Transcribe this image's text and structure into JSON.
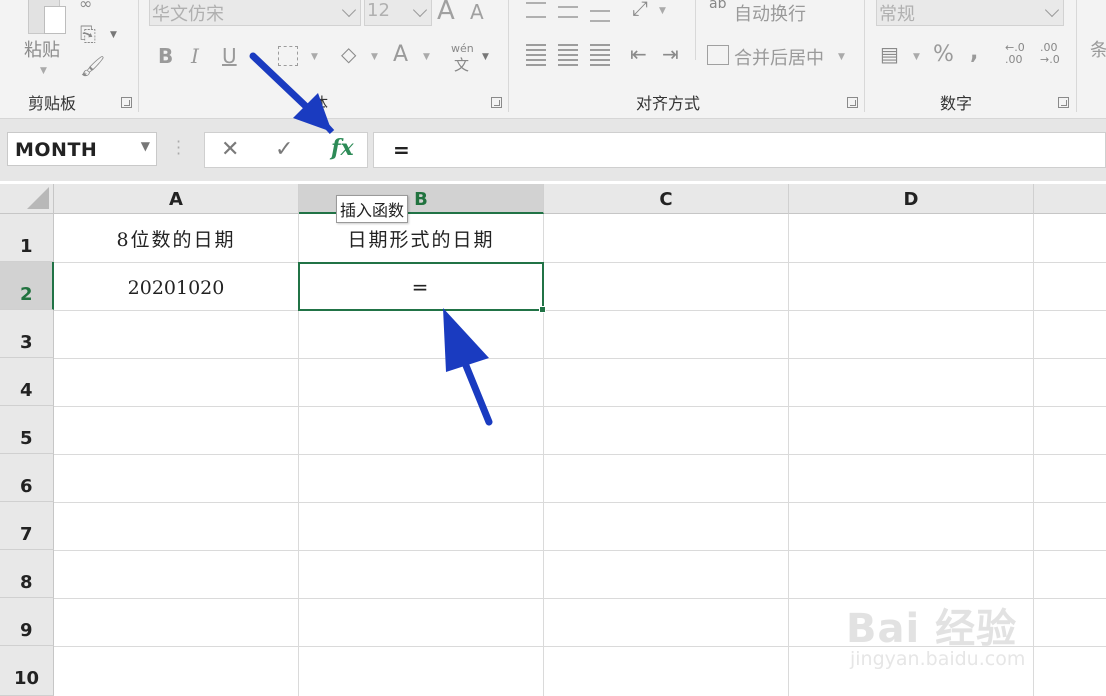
{
  "ribbon": {
    "clipboard": {
      "paste_label": "粘贴",
      "group_label": "剪贴板"
    },
    "font": {
      "font_name": "华文仿宋",
      "font_size": "12",
      "grow_icon": "A",
      "shrink_icon": "A",
      "bold": "B",
      "italic": "I",
      "underline": "U",
      "font_color_icon": "A",
      "phonetic_top": "wén",
      "phonetic_bottom": "文",
      "group_label_partial": "体"
    },
    "alignment": {
      "wrap_text_icon": "ab",
      "wrap_text_label": "自动换行",
      "merge_center_label": "合并后居中",
      "group_label": "对齐方式"
    },
    "number": {
      "format_value": "常规",
      "percent": "%",
      "comma": ",",
      "inc_decimal": "←.0\n.00",
      "dec_decimal": ".00\n→.0",
      "group_label": "数字"
    },
    "next_group_partial": "条"
  },
  "formula_bar": {
    "name_box_value": "MONTH",
    "cancel_icon": "✕",
    "enter_icon": "✓",
    "fx_label": "fx",
    "formula_value": "=",
    "tooltip": "插入函数"
  },
  "grid": {
    "columns": [
      "A",
      "B",
      "C",
      "D"
    ],
    "rows": [
      "1",
      "2",
      "3",
      "4",
      "5",
      "6",
      "7",
      "8",
      "9",
      "10"
    ],
    "cells": {
      "A1": "8位数的日期",
      "B1": "日期形式的日期",
      "A2": "20201020",
      "B2": "="
    },
    "active_cell": "B2"
  },
  "watermark": {
    "main": "Bai 经验",
    "sub": "jingyan.baidu.com"
  },
  "colors": {
    "excel_green": "#217346",
    "arrow_blue": "#1a3bc0"
  }
}
